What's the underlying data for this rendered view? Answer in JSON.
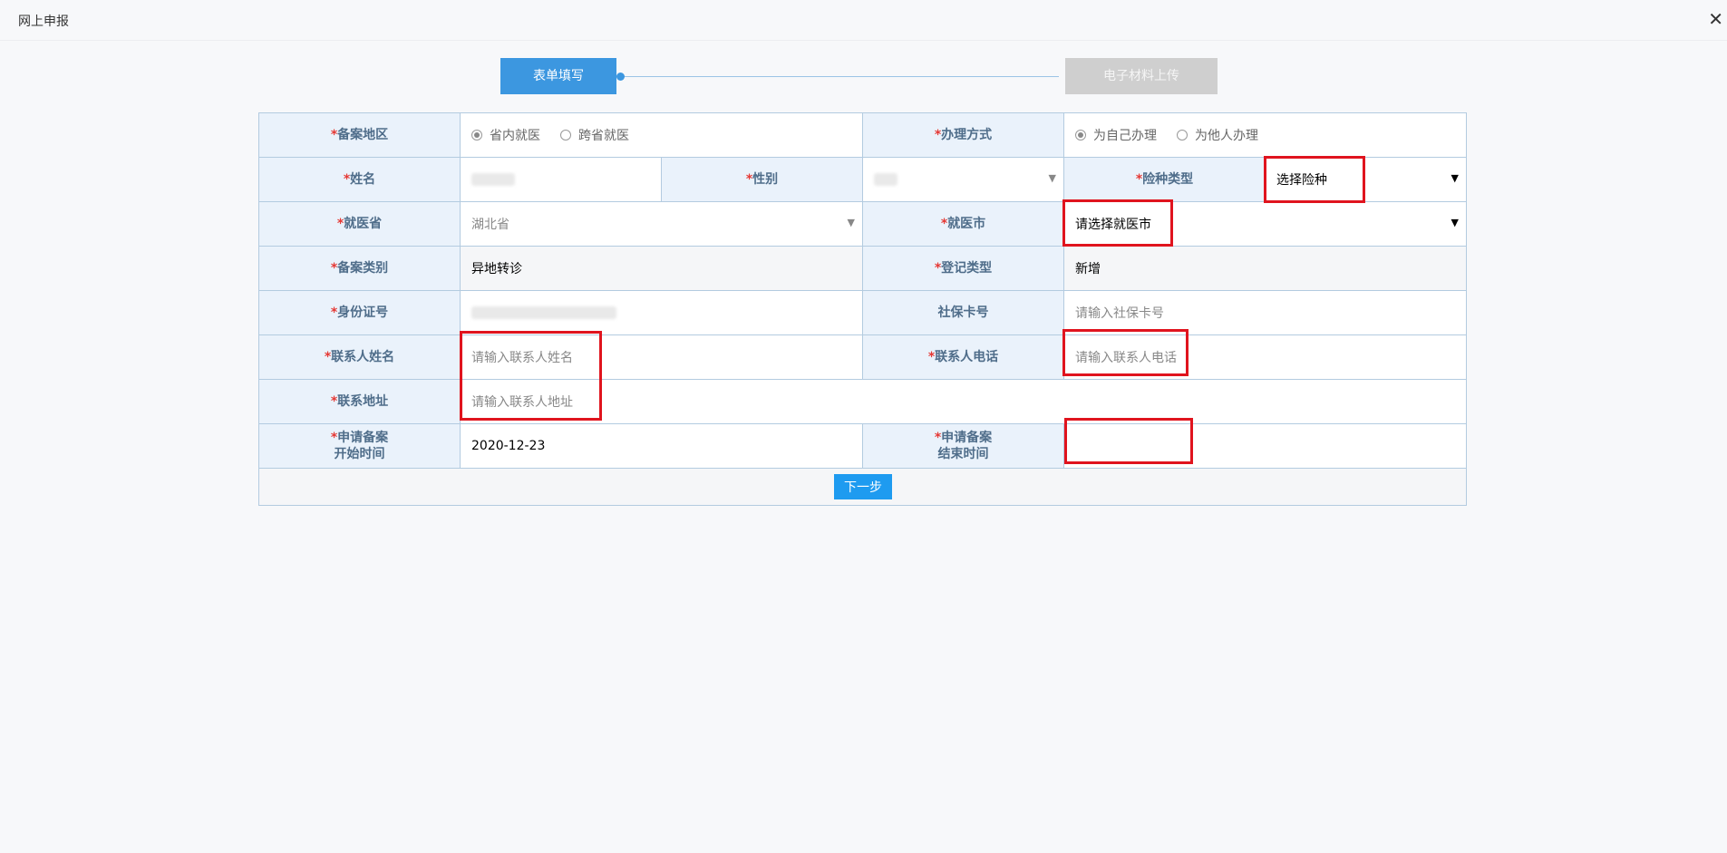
{
  "window": {
    "title": "网上申报",
    "close_icon": "close-icon"
  },
  "steps": [
    {
      "label": "表单填写",
      "active": true
    },
    {
      "label": "电子材料上传",
      "active": false
    }
  ],
  "form": {
    "registration_area": {
      "label": "备案地区",
      "options": [
        "省内就医",
        "跨省就医"
      ],
      "selected": "省内就医"
    },
    "handling_method": {
      "label": "办理方式",
      "options": [
        "为自己办理",
        "为他人办理"
      ],
      "selected": "为自己办理"
    },
    "name": {
      "label": "姓名"
    },
    "gender": {
      "label": "性别"
    },
    "insurance_type": {
      "label": "险种类型",
      "placeholder": "选择险种"
    },
    "medical_province": {
      "label": "就医省",
      "value": "湖北省"
    },
    "medical_city": {
      "label": "就医市",
      "placeholder": "请选择就医市"
    },
    "registration_category": {
      "label": "备案类别",
      "value": "异地转诊"
    },
    "registration_type": {
      "label": "登记类型",
      "value": "新增"
    },
    "id_number": {
      "label": "身份证号"
    },
    "social_security_card": {
      "label": "社保卡号",
      "placeholder": "请输入社保卡号"
    },
    "contact_name": {
      "label": "联系人姓名",
      "placeholder": "请输入联系人姓名"
    },
    "contact_phone": {
      "label": "联系人电话",
      "placeholder": "请输入联系人电话"
    },
    "contact_address": {
      "label": "联系地址",
      "placeholder": "请输入联系人地址"
    },
    "start_date": {
      "label_line1": "申请备案",
      "label_line2": "开始时间",
      "value": "2020-12-23"
    },
    "end_date": {
      "label_line1": "申请备案",
      "label_line2": "结束时间",
      "value": ""
    },
    "required_mark": "*",
    "next_button": "下一步"
  },
  "colors": {
    "accent": "#3c97e0",
    "highlight": "#e0141e",
    "label_bg": "#eaf2fb"
  }
}
